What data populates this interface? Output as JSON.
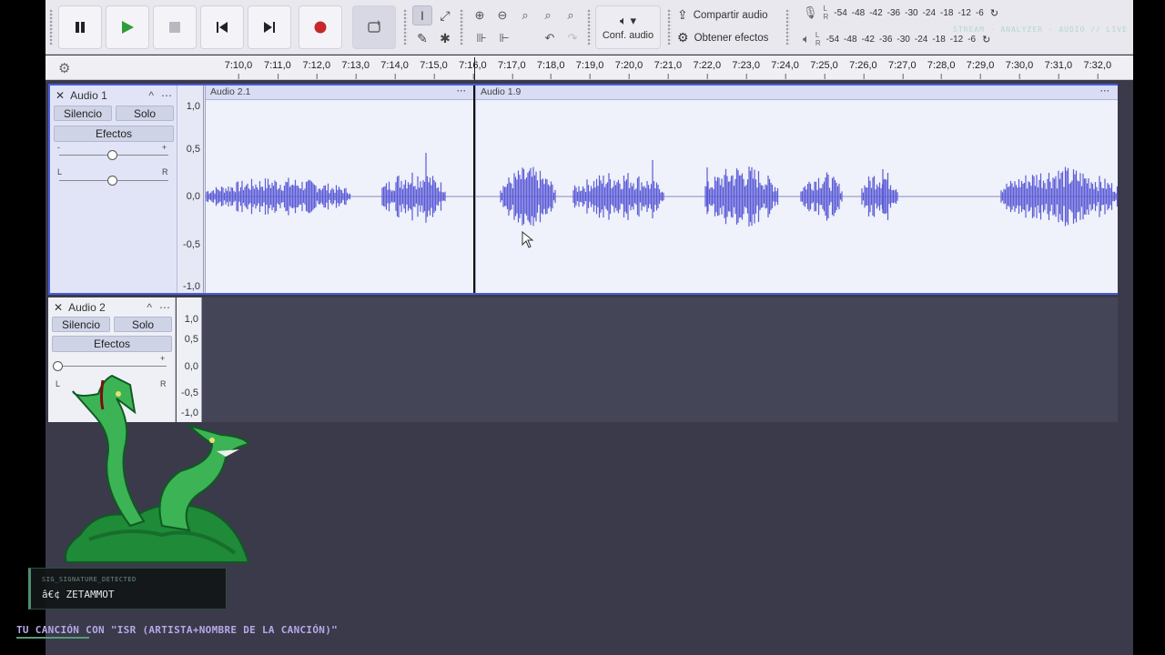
{
  "toolbar": {
    "pause_icon": "pause-icon",
    "play_icon": "play-icon",
    "stop_icon": "stop-icon",
    "skip_start_icon": "skip-to-start-icon",
    "skip_end_icon": "skip-to-end-icon",
    "record_icon": "record-icon",
    "loop_icon": "loop-icon",
    "audio_setup_label": "Conf. audio",
    "share_audio_label": "Compartir audio",
    "get_effects_label": "Obtener efectos",
    "record_meter_scale": [
      "-54",
      "-48",
      "-42",
      "-36",
      "-30",
      "-24",
      "-18",
      "-12",
      "-6"
    ],
    "play_meter_scale": [
      "-54",
      "-48",
      "-42",
      "-36",
      "-30",
      "-24",
      "-18",
      "-12",
      "-6"
    ],
    "meter_channels": [
      "L",
      "R"
    ],
    "record_color": "#c62828",
    "play_color": "#2e9e3a"
  },
  "ruler": {
    "ticks": [
      "7:10,0",
      "7:11,0",
      "7:12,0",
      "7:13,0",
      "7:14,0",
      "7:15,0",
      "7:16,0",
      "7:17,0",
      "7:18,0",
      "7:19,0",
      "7:20,0",
      "7:21,0",
      "7:22,0",
      "7:23,0",
      "7:24,0",
      "7:25,0",
      "7:26,0",
      "7:27,0",
      "7:28,0",
      "7:29,0",
      "7:30,0",
      "7:31,0",
      "7:32,0"
    ]
  },
  "tracks": [
    {
      "name": "Audio 1",
      "mute_label": "Silencio",
      "solo_label": "Solo",
      "effects_label": "Efectos",
      "gain_min": "-",
      "gain_max": "+",
      "pan_left": "L",
      "pan_right": "R",
      "scale": [
        "1,0",
        "0,5",
        "0,0",
        "-0,5",
        "-1,0"
      ],
      "clips": [
        {
          "name": "Audio 2.1"
        },
        {
          "name": "Audio 1.9"
        }
      ],
      "selected": true
    },
    {
      "name": "Audio 2",
      "mute_label": "Silencio",
      "solo_label": "Solo",
      "effects_label": "Efectos",
      "gain_min": "-",
      "gain_max": "+",
      "pan_left": "L",
      "pan_right": "R",
      "scale": [
        "1,0",
        "0,5",
        "0,0",
        "-0,5",
        "-1,0"
      ]
    }
  ],
  "clip_menu_glyph": "⋯",
  "track_close_glyph": "✕",
  "track_collapse_glyph": "^",
  "waveform_color": "#5b5bd6",
  "overlay": {
    "signature_label": "SIG_SIGNATURE_DETECTED",
    "signature_value": "â€¢ ZETAMMOT",
    "ticker_text": "TU CANCIÓN CON \"ISR (ARTISTA+NOMBRE DE LA CANCIÓN)\"",
    "top_stream_text": "STREAM · ANALYZER · AUDIO // LIVE"
  }
}
